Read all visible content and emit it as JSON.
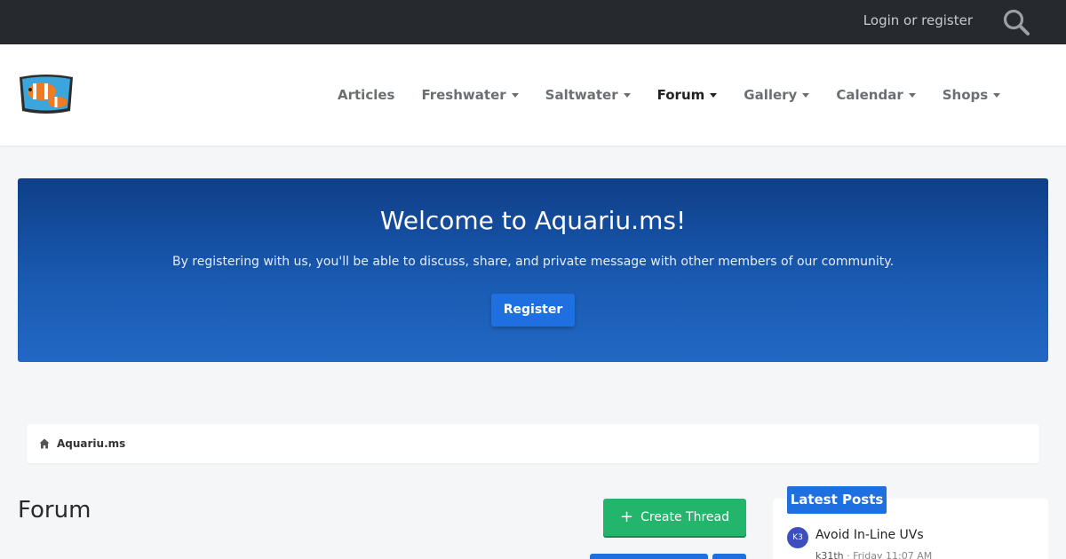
{
  "topbar": {
    "login_label": "Login or register",
    "search_icon": "search-icon"
  },
  "header": {
    "logo_icon": "clownfish-logo",
    "nav": [
      {
        "label": "Articles",
        "has_dropdown": false,
        "active": false
      },
      {
        "label": "Freshwater",
        "has_dropdown": true,
        "active": false
      },
      {
        "label": "Saltwater",
        "has_dropdown": true,
        "active": false
      },
      {
        "label": "Forum",
        "has_dropdown": true,
        "active": true
      },
      {
        "label": "Gallery",
        "has_dropdown": true,
        "active": false
      },
      {
        "label": "Calendar",
        "has_dropdown": true,
        "active": false
      },
      {
        "label": "Shops",
        "has_dropdown": true,
        "active": false
      }
    ]
  },
  "banner": {
    "title": "Welcome to Aquariu.ms!",
    "text": "By registering with us, you'll be able to discuss, share, and private message with other members of our community.",
    "register_label": "Register"
  },
  "breadcrumb": {
    "home_icon": "home-icon",
    "label": "Aquariu.ms"
  },
  "main": {
    "title": "Forum",
    "create_thread_label": "Create Thread"
  },
  "sidebar": {
    "latest_posts_label": "Latest Posts",
    "posts": [
      {
        "avatar": "K3",
        "title": "Avoid In-Line UVs",
        "author": "k31th",
        "time": "Friday 11:07 AM"
      }
    ]
  },
  "colors": {
    "topbar": "#262a2e",
    "accent": "#1e6fe0",
    "banner": "#1a5cb4",
    "create_button": "#24b56d"
  }
}
